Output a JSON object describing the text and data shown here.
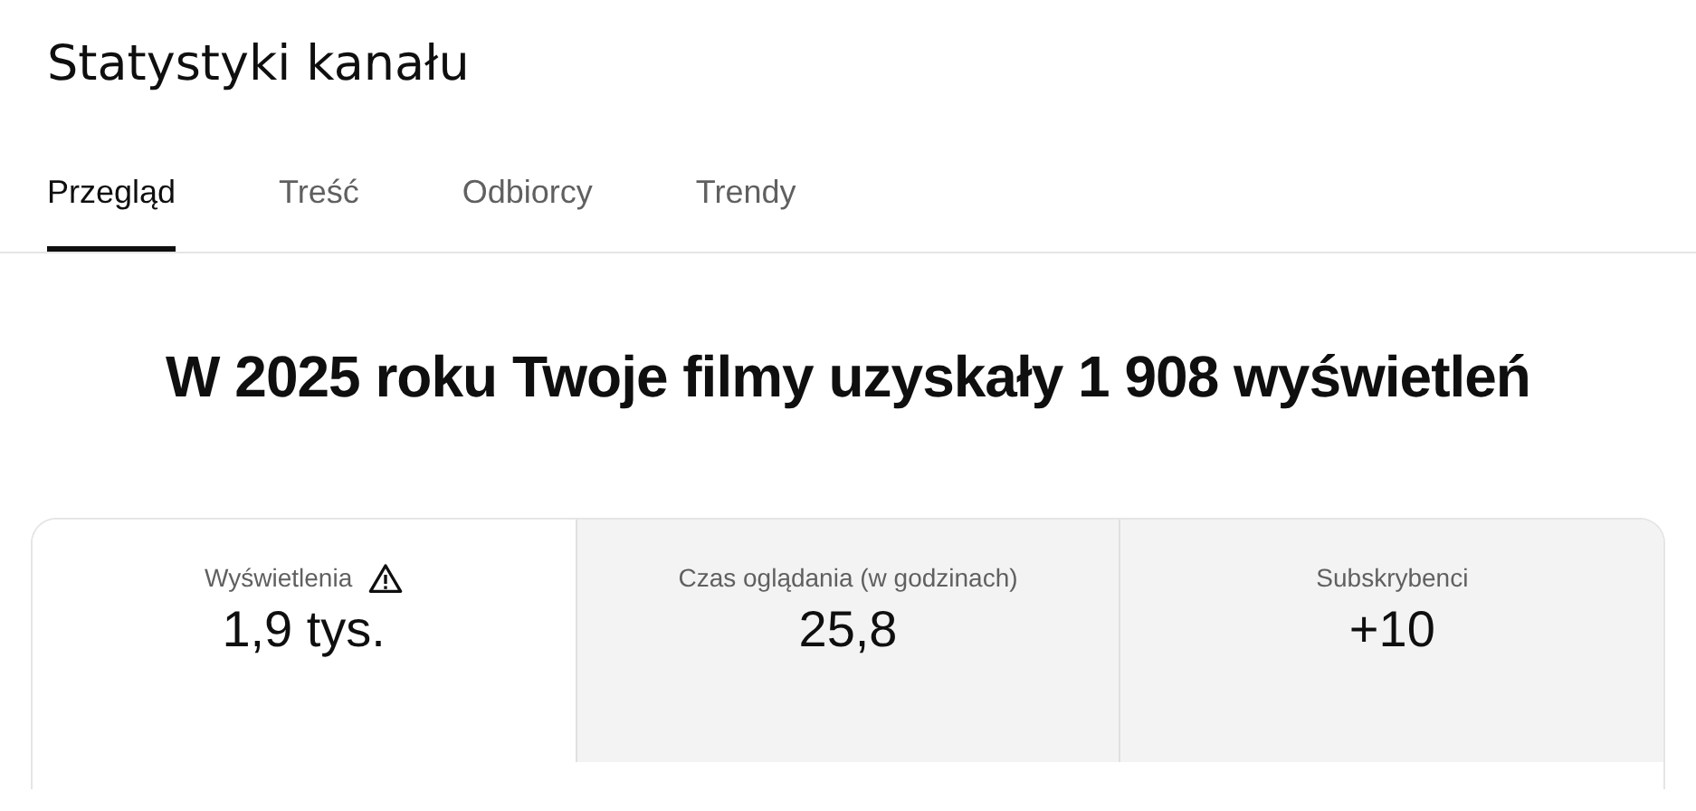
{
  "page": {
    "title": "Statystyki kanału"
  },
  "tabs": [
    {
      "label": "Przegląd",
      "selected": true
    },
    {
      "label": "Treść",
      "selected": false
    },
    {
      "label": "Odbiorcy",
      "selected": false
    },
    {
      "label": "Trendy",
      "selected": false
    }
  ],
  "headline": "W 2025 roku Twoje filmy uzyskały 1 908 wyświetleń",
  "metrics": [
    {
      "label": "Wyświetlenia",
      "value": "1,9 tys.",
      "warning": true,
      "selected": true
    },
    {
      "label": "Czas oglądania (w godzinach)",
      "value": "25,8",
      "warning": false,
      "selected": false
    },
    {
      "label": "Subskrybenci",
      "value": "+10",
      "warning": false,
      "selected": false
    }
  ]
}
